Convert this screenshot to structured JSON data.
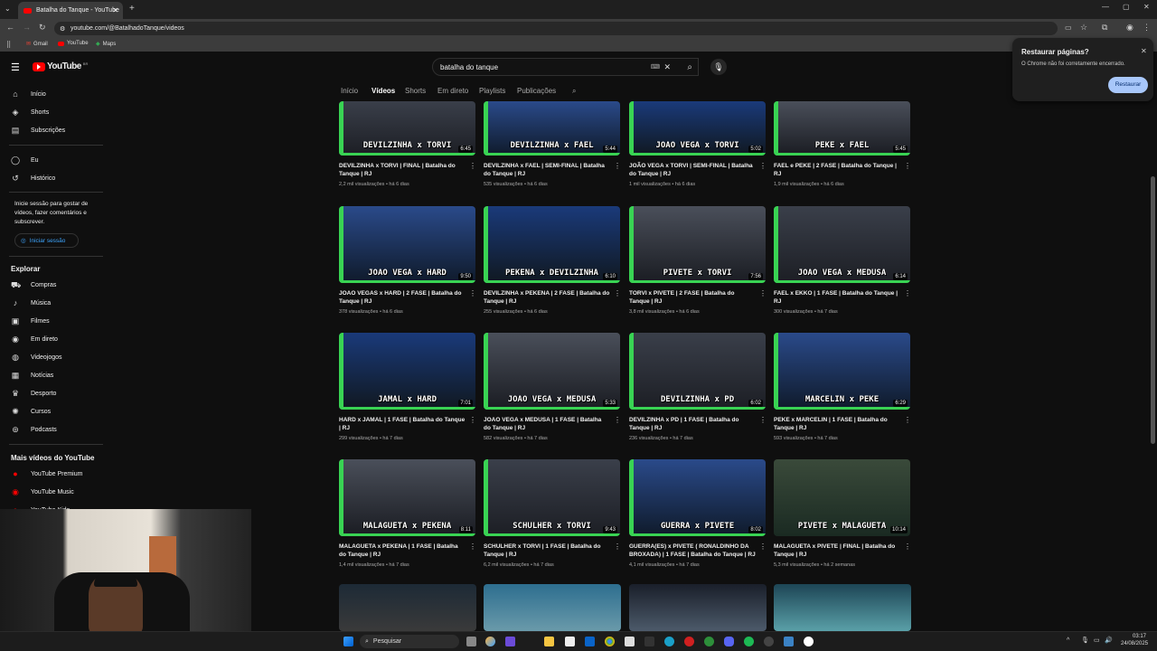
{
  "browser": {
    "tab_title": "Batalha do Tanque - YouTube",
    "url": "youtube.com/@BatalhadoTanque/videos",
    "bookmarks": [
      "Gmail",
      "YouTube",
      "Maps"
    ]
  },
  "restore_popup": {
    "title": "Restaurar páginas?",
    "message": "O Chrome não foi corretamente encerrado.",
    "button": "Restaurar"
  },
  "youtube": {
    "logo": "YouTube",
    "region": "BR",
    "search_value": "batalha do tanque",
    "channel_tabs": [
      "Início",
      "Vídeos",
      "Shorts",
      "Em direto",
      "Playlists",
      "Publicações"
    ],
    "active_tab": "Vídeos"
  },
  "sidebar": {
    "main": [
      "Início",
      "Shorts",
      "Subscrições"
    ],
    "you": [
      "Eu",
      "Histórico"
    ],
    "signin_text": "Inicie sessão para gostar de vídeos, fazer comentários e subscrever.",
    "signin_button": "Iniciar sessão",
    "explore_header": "Explorar",
    "explore": [
      "Compras",
      "Música",
      "Filmes",
      "Em direto",
      "Videojogos",
      "Notícias",
      "Desporto",
      "Cursos",
      "Podcasts"
    ],
    "more_header": "Mais vídeos do YouTube",
    "more": [
      "YouTube Premium",
      "YouTube Music",
      "YouTube Kids"
    ]
  },
  "videos": [
    {
      "label": "DEVILZINHA x TORVI",
      "duration": "6:45",
      "title": "DEVILZINHA x TORVI | FINAL | Batalha do Tanque | RJ",
      "meta": "2,2 mil visualizações • há 6 dias"
    },
    {
      "label": "DEVILZINHA x FAEL",
      "duration": "5:44",
      "title": "DEVILZINHA x FAEL | SEMI-FINAL | Batalha do Tanque | RJ",
      "meta": "535 visualizações • há 6 dias"
    },
    {
      "label": "JOAO VEGA x TORVI",
      "duration": "5:02",
      "title": "JOÃO VEGA x TORVI | SEMI-FINAL | Batalha do Tanque | RJ",
      "meta": "1 mil visualizações • há 6 dias"
    },
    {
      "label": "PEKE x FAEL",
      "duration": "5:45",
      "title": "FAEL e PEKE | 2 FASE | Batalha do Tanque | RJ",
      "meta": "1,9 mil visualizações • há 6 dias"
    },
    {
      "label": "JOAO VEGA x HARD",
      "duration": "9:50",
      "title": "JOAO VEGAS x HARD | 2 FASE | Batalha do Tanque | RJ",
      "meta": "378 visualizações • há 6 dias"
    },
    {
      "label": "PEKENA x DEVILZINHA",
      "duration": "6:10",
      "title": "DEVILZINHA x PEKENA | 2 FASE | Batalha do Tanque | RJ",
      "meta": "255 visualizações • há 6 dias"
    },
    {
      "label": "PIVETE x TORVI",
      "duration": "7:56",
      "title": "TORVI x PIVETE | 2 FASE | Batalha do Tanque | RJ",
      "meta": "3,8 mil visualizações • há 6 dias"
    },
    {
      "label": "JOAO VEGA x MEDUSA",
      "duration": "6:14",
      "title": "FAEL x EKKO | 1 FASE | Batalha do Tanque | RJ",
      "meta": "300 visualizações • há 7 dias"
    },
    {
      "label": "JAMAL x HARD",
      "duration": "7:01",
      "title": "HARD x JAMAL | 1 FASE | Batalha do Tanque | RJ",
      "meta": "299 visualizações • há 7 dias"
    },
    {
      "label": "JOAO VEGA x MEDUSA",
      "duration": "5:33",
      "title": "JOAO VEGA x MEDUSA | 1 FASE | Batalha do Tanque | RJ",
      "meta": "582 visualizações • há 7 dias"
    },
    {
      "label": "DEVILZINHA x PD",
      "duration": "6:02",
      "title": "DEVILZINHA x PD | 1 FASE | Batalha do Tanque | RJ",
      "meta": "236 visualizações • há 7 dias"
    },
    {
      "label": "MARCELIN x PEKE",
      "duration": "6:29",
      "title": "PEKE x MARCELIN | 1 FASE | Batalha do Tanque | RJ",
      "meta": "593 visualizações • há 7 dias"
    },
    {
      "label": "MALAGUETA x PEKENA",
      "duration": "8:11",
      "title": "MALAGUETA x PEKENA | 1 FASE | Batalha do Tanque | RJ",
      "meta": "1,4 mil visualizações • há 7 dias"
    },
    {
      "label": "SCHULHER x TORVI",
      "duration": "9:43",
      "title": "SCHULHER x TORVI | 1 FASE | Batalha do Tanque | RJ",
      "meta": "6,2 mil visualizações • há 7 dias"
    },
    {
      "label": "GUERRA x PIVETE",
      "duration": "8:02",
      "title": "GUERRA(ES) x PIVETE ( RONALDINHO DA BROXADA) | 1 FASE | Batalha do Tanque | RJ",
      "meta": "4,1 mil visualizações • há 7 dias"
    },
    {
      "label": "PIVETE x MALAGUETA",
      "duration": "10:14",
      "title": "MALAGUETA x PIVETE | FINAL | Batalha do Tanque | RJ",
      "meta": "5,3 mil visualizações • há 2 semanas"
    }
  ],
  "taskbar": {
    "search": "Pesquisar",
    "time": "03:17",
    "date": "24/08/2025"
  },
  "colors": {
    "accent_green": "#39d353",
    "yt_red": "#ff0000",
    "bg": "#0f0f0f"
  }
}
